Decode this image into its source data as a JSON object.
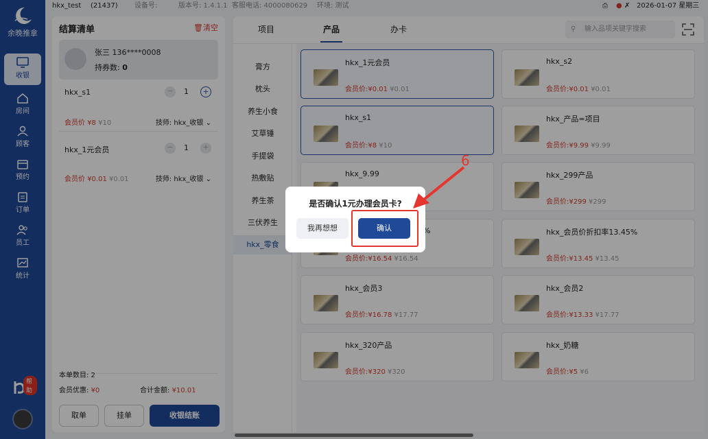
{
  "app": {
    "name": "余晚推拿"
  },
  "nav": [
    {
      "id": "cashier",
      "label": "收银",
      "icon": "monitor-icon",
      "active": true
    },
    {
      "id": "rooms",
      "label": "房间",
      "icon": "home-icon",
      "active": false
    },
    {
      "id": "guests",
      "label": "顾客",
      "icon": "user-icon",
      "active": false
    },
    {
      "id": "booking",
      "label": "预约",
      "icon": "calendar-icon",
      "active": false
    },
    {
      "id": "orders",
      "label": "订单",
      "icon": "clipboard-icon",
      "active": false
    },
    {
      "id": "staff",
      "label": "员工",
      "icon": "staff-icon",
      "active": false
    },
    {
      "id": "stats",
      "label": "统计",
      "icon": "chart-icon",
      "active": false
    }
  ],
  "help": {
    "badge": "帮助"
  },
  "statusbar": {
    "account": "hkx_test",
    "id": "(21437)",
    "device": "设备号:",
    "version": "版本号: 1.4.1.1",
    "phone": "客服电话: 4000080629",
    "env": "环境: 测试",
    "datetime": "2026-01-07 星期三"
  },
  "cart": {
    "title": "结算清单",
    "clear": "清空",
    "member": {
      "name": "张三 136****0008",
      "coupon_label": "持券数:",
      "coupon_count": "0"
    },
    "items": [
      {
        "name": "hkx_s1",
        "qty": "1",
        "member_price": "会员价",
        "price": "¥8",
        "orig": "¥10",
        "tech": "技师: hkx_收银"
      },
      {
        "name": "hkx_1元会员",
        "qty": "1",
        "member_price": "会员价",
        "price": "¥0.01",
        "orig": "¥0.01",
        "tech": "技师: hkx_收银"
      }
    ],
    "count_label": "本单数目: 2",
    "discount_label": "会员优惠:",
    "discount": "¥0",
    "total_label": "合计金额:",
    "total": "¥10.01",
    "buttons": {
      "take": "取单",
      "hang": "挂单",
      "checkout": "收银结账"
    }
  },
  "tabs": [
    {
      "label": "项目"
    },
    {
      "label": "产品"
    },
    {
      "label": "办卡"
    }
  ],
  "search": {
    "placeholder": "输入品项关键字搜索"
  },
  "categories": [
    "膏方",
    "枕头",
    "养生小食",
    "艾草锤",
    "手提袋",
    "热敷贴",
    "养生茶",
    "三伏养生",
    "hkx_零食"
  ],
  "products": [
    {
      "name": "hkx_1元会员",
      "mp": "会员价:¥0.01",
      "orig": "¥0.01",
      "selected": true
    },
    {
      "name": "hkx_s2",
      "mp": "会员价:¥0.01",
      "orig": "¥0.01",
      "selected": false
    },
    {
      "name": "hkx_s1",
      "mp": "会员价:¥8",
      "orig": "¥10",
      "selected": true
    },
    {
      "name": "hkx_产品=项目",
      "mp": "会员价:¥9.99",
      "orig": "¥9.99",
      "selected": false
    },
    {
      "name": "hkx_9.99",
      "mp": "",
      "orig": "",
      "selected": false
    },
    {
      "name": "hkx_299产品",
      "mp": "会员价:¥299",
      "orig": "¥299",
      "selected": false
    },
    {
      "name": "%",
      "mp": "会员价:¥16.54",
      "orig": "¥16.54",
      "selected": false
    },
    {
      "name": "hkx_会员价折扣率13.45%",
      "mp": "会员价:¥13.45",
      "orig": "¥13.45",
      "selected": false
    },
    {
      "name": "hkx_会员3",
      "mp": "会员价:¥16.78",
      "orig": "¥17.77",
      "selected": false
    },
    {
      "name": "hkx_会员2",
      "mp": "会员价:¥13.33",
      "orig": "¥17.77",
      "selected": false
    },
    {
      "name": "hkx_320产品",
      "mp": "会员价:¥320",
      "orig": "¥320",
      "selected": false
    },
    {
      "name": "hkx_奶糖",
      "mp": "会员价:¥5",
      "orig": "¥6",
      "selected": false
    }
  ],
  "dialog": {
    "question": "是否确认1元办理会员卡?",
    "cancel": "我再想想",
    "confirm": "确认"
  },
  "annotation": {
    "step": "6",
    "color": "#e6352f"
  },
  "colors": {
    "brand": "#1e4a98",
    "price_red": "#d23b2f"
  }
}
